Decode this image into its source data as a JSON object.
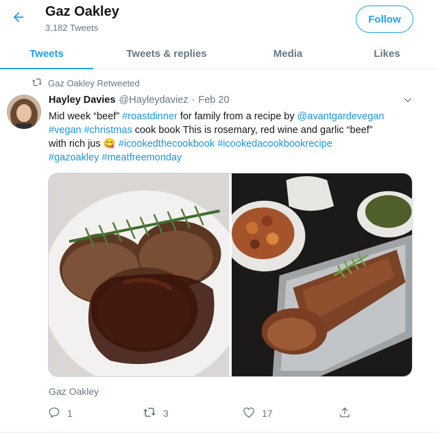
{
  "header": {
    "title": "Gaz Oakley",
    "tweet_count": "3,182 Tweets",
    "follow_label": "Follow",
    "back_icon": "arrow-left-icon"
  },
  "tabs": [
    {
      "label": "Tweets",
      "active": true
    },
    {
      "label": "Tweets & replies",
      "active": false
    },
    {
      "label": "Media",
      "active": false
    },
    {
      "label": "Likes",
      "active": false
    }
  ],
  "tweet": {
    "retweet_label": "Gaz Oakley Retweeted",
    "author_name": "Hayley Davies",
    "author_handle": "@Hayleydaviez",
    "separator": "·",
    "date": "Feb 20",
    "text": {
      "t1": "Mid week “beef” ",
      "h_roastdinner": "#roastdinner",
      "t2": " for family from a recipe by ",
      "m_avantgardevegan": "@avantgardevegan",
      "h_vegan": "#vegan",
      "h_christmas": "#christmas",
      "t3": " cook book This is rosemary, red wine and garlic “beef”",
      "t4": "with rich jus ",
      "emoji": "😋",
      "h_icookedthecookbook": "#icookedthecookbook",
      "h_icookedacookbookrecipe": "#icookedacookbookrecipe",
      "h_gazoakley": "#gazoakley",
      "h_meatfreemonday": "#meatfreemonday"
    },
    "footer_name": "Gaz Oakley",
    "replies": "1",
    "retweets": "3",
    "likes": "17"
  },
  "colors": {
    "accent": "#1da1f2",
    "link": "#1b95e0",
    "muted": "#657786",
    "text": "#14171a",
    "border": "#e6ecf0"
  },
  "icons": [
    "arrow-left-icon",
    "retweet-icon",
    "chevron-down-icon",
    "reply-icon",
    "heart-icon",
    "share-icon"
  ]
}
